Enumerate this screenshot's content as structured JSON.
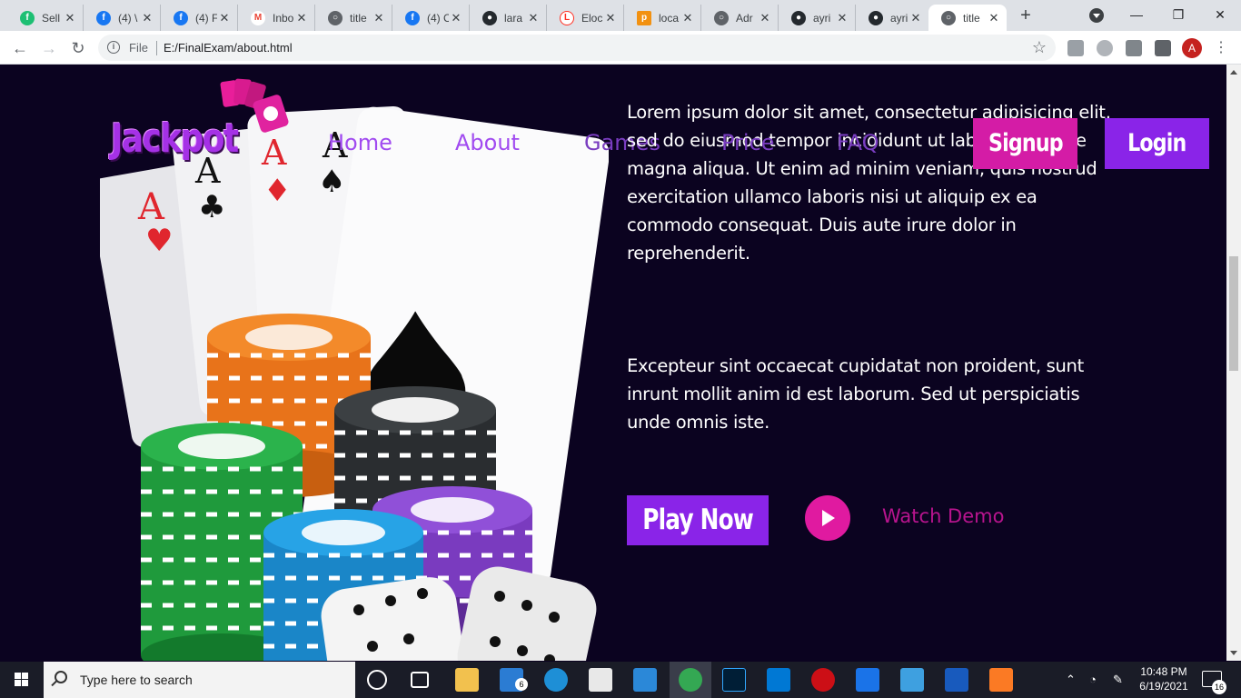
{
  "browser": {
    "tabs": [
      {
        "label": "Sell",
        "icon": "fiverr-icon",
        "color": "#1dbf73"
      },
      {
        "label": "(4) \\",
        "icon": "facebook-icon",
        "color": "#1877f2"
      },
      {
        "label": "(4) F",
        "icon": "facebook-icon",
        "color": "#1877f2"
      },
      {
        "label": "Inbo",
        "icon": "gmail-icon",
        "color": "#ea4335"
      },
      {
        "label": "title",
        "icon": "globe-icon",
        "color": "#5f6368"
      },
      {
        "label": "(4) C",
        "icon": "facebook-icon",
        "color": "#1877f2"
      },
      {
        "label": "lara",
        "icon": "github-icon",
        "color": "#24292e"
      },
      {
        "label": "Eloc",
        "icon": "laravel-icon",
        "color": "#ff2d20"
      },
      {
        "label": "loca",
        "icon": "phpmyadmin-icon",
        "color": "#f29111"
      },
      {
        "label": "Adr",
        "icon": "globe-icon",
        "color": "#5f6368"
      },
      {
        "label": "ayri",
        "icon": "github-icon",
        "color": "#24292e"
      },
      {
        "label": "ayri",
        "icon": "github-icon",
        "color": "#24292e"
      },
      {
        "label": "title",
        "icon": "globe-icon",
        "color": "#5f6368",
        "active": true
      }
    ],
    "address": {
      "scheme_label": "File",
      "url": "E:/FinalExam/about.html"
    },
    "profile_initial": "A"
  },
  "page": {
    "logo_text": "Jackpot",
    "nav": [
      {
        "label": "Home"
      },
      {
        "label": "About"
      },
      {
        "label": "Games"
      },
      {
        "label": "Price"
      },
      {
        "label": "FAQ"
      }
    ],
    "signup_label": "Signup",
    "login_label": "Login",
    "paragraph_1": "Lorem ipsum dolor sit amet, consectetur adipisicing elit, sed do eiusmod tempor incididunt ut labore et dolore magna aliqua. Ut enim ad minim veniam, quis nostrud exercitation ullamco laboris nisi ut aliquip ex ea commodo consequat. Duis aute irure dolor in reprehenderit.",
    "paragraph_2": "Excepteur sint occaecat cupidatat non proident, sunt inrunt mollit anim id est laborum. Sed ut perspiciatis unde omnis iste.",
    "play_now_label": "Play Now",
    "watch_demo_label": "Watch Demo",
    "colors": {
      "background": "#0b0320",
      "accent_purple": "#8a24e8",
      "accent_pink": "#e01aa0",
      "nav_text": "#a14bf0"
    }
  },
  "taskbar": {
    "search_placeholder": "Type here to search",
    "time": "10:48 PM",
    "date": "6/19/2021",
    "notification_count": "16",
    "mail_badge": "6"
  }
}
